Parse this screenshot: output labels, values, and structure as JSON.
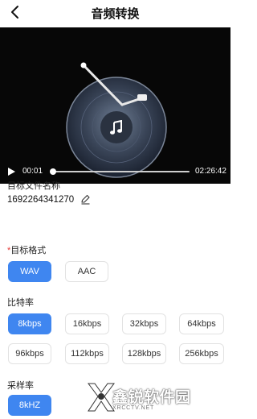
{
  "header": {
    "title": "音频转换",
    "back_icon": "chevron-left-icon"
  },
  "player": {
    "current_time": "00:01",
    "total_time": "02:26:42",
    "progress": 0.005,
    "play_icon": "play-icon",
    "center_icon": "music-note-icon"
  },
  "file": {
    "label": "目标文件名称",
    "name": "1692264341270",
    "edit_icon": "pencil-icon"
  },
  "format": {
    "required_mark": "*",
    "label": "目标格式",
    "options": [
      "WAV",
      "AAC"
    ],
    "selected": "WAV"
  },
  "bitrate": {
    "label": "比特率",
    "options": [
      "8kbps",
      "16kbps",
      "32kbps",
      "64kbps",
      "96kbps",
      "112kbps",
      "128kbps",
      "256kbps"
    ],
    "selected": "8kbps"
  },
  "samplerate": {
    "label": "采样率",
    "options": [
      "8kHZ"
    ],
    "selected": "8kHZ"
  },
  "watermark": {
    "text": "鑫锐软件园",
    "url": "XRCCTV.NET"
  },
  "colors": {
    "accent": "#3f86f0",
    "player_bg": "#070707"
  }
}
